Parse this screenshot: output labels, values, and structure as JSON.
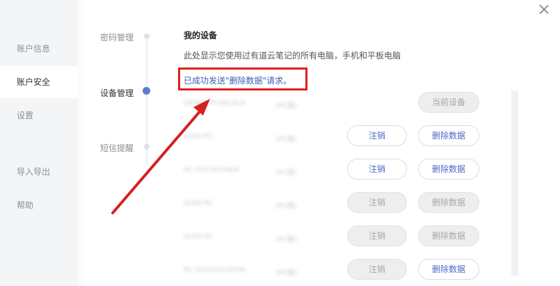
{
  "sidebar": {
    "items": [
      {
        "label": "账户信息"
      },
      {
        "label": "账户安全"
      },
      {
        "label": "设置"
      },
      {
        "label": "导入导出"
      },
      {
        "label": "帮助"
      }
    ]
  },
  "steps": [
    {
      "label": "密码管理"
    },
    {
      "label": "设备管理"
    },
    {
      "label": "短信提醒"
    }
  ],
  "main": {
    "title": "我的设备",
    "description": "此处显示您使用过有道云笔记的所有电脑，手机和平板电脑",
    "success_message": "已成功发送\"删除数据\"请求。"
  },
  "devices": [
    {
      "name": "DESKTOP-0SCALD",
      "type": "(PC版)",
      "current_label": "当前设备"
    },
    {
      "name": "SUDY-PC",
      "type": "(PC版)",
      "logout_label": "注销",
      "delete_label": "删除数据"
    },
    {
      "name": "PC-201703VIKM",
      "type": "(PC版)",
      "logout_label": "注销",
      "delete_label": "删除数据"
    },
    {
      "name": "SUDY-PC",
      "type": "(PC版)",
      "logout_label": "注销",
      "delete_label": "删除数据"
    },
    {
      "name": "SUDY-PC",
      "type": "(PC版)",
      "logout_label": "注销",
      "delete_label": "删除数据"
    },
    {
      "name": "PC-20161010FCM",
      "type": "(PC版)",
      "logout_label": "注销",
      "delete_label": "删除数据"
    }
  ],
  "colors": {
    "accent": "#5b7bd0",
    "highlight_box": "#e01e1e",
    "annotation_arrow": "#d62020",
    "success_text": "#3b5fb3"
  }
}
